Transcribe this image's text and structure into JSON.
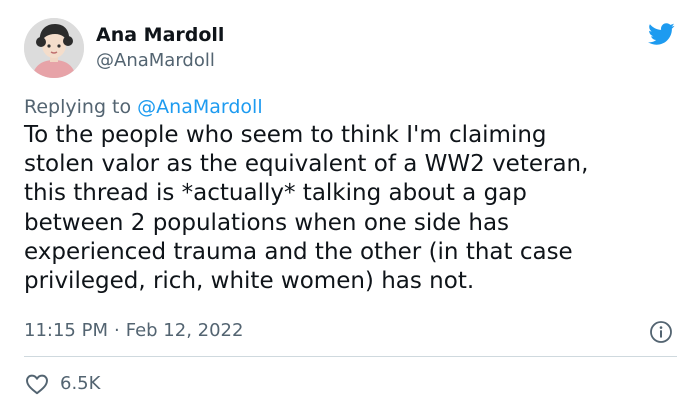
{
  "author": {
    "name": "Ana Mardoll",
    "handle": "@AnaMardoll"
  },
  "reply": {
    "prefix": "Replying to",
    "to": "@AnaMardoll"
  },
  "text_lines": [
    "To the people who seem to think I'm claiming",
    "stolen valor as the equivalent of a WW2 veteran,",
    "this thread is *actually* talking about a gap",
    "between 2 populations when one side has",
    "experienced trauma and the other (in that case",
    "privileged, rich, white women) has not."
  ],
  "meta": {
    "time": "11:15 PM",
    "separator": "·",
    "date": "Feb 12, 2022"
  },
  "stats": {
    "likes": "6.5K"
  },
  "icons": {
    "brand": "twitter-bird-icon",
    "info": "info-icon",
    "like": "heart-icon"
  },
  "colors": {
    "brand_blue": "#1d9bf0",
    "text": "#0f1419",
    "secondary": "#536471",
    "divider": "#cfd9de"
  }
}
